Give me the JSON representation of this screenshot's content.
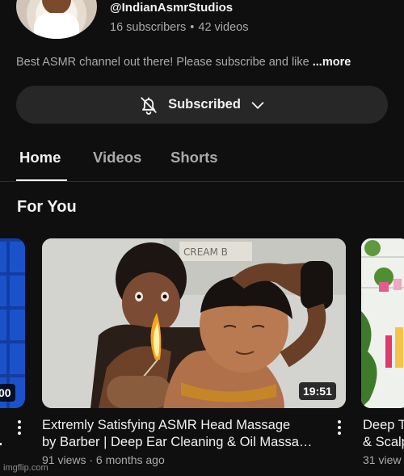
{
  "channel": {
    "handle": "@IndianAsmrStudios",
    "subscribers": "16 subscribers",
    "separator": "•",
    "videos": "42 videos",
    "description": "Best ASMR channel out there! Please subscribe and like ",
    "more": "...more"
  },
  "subscribe": {
    "label": "Subscribed",
    "icons": [
      "bell-off-icon",
      "chevron-down-icon"
    ]
  },
  "tabs": [
    {
      "label": "Home",
      "active": true
    },
    {
      "label": "Videos",
      "active": false
    },
    {
      "label": "Shorts",
      "active": false
    }
  ],
  "section": {
    "title": "For You"
  },
  "videos": [
    {
      "duration": "00",
      "title_line": "",
      "meta": ""
    },
    {
      "duration": "19:51",
      "title_line1": "Extremly Satisfying ASMR Head Massage",
      "title_line2": "by Barber | Deep Ear Cleaning & Oil Massa…",
      "meta": "91 views · 6 months ago"
    },
    {
      "title_line1": "Deep T",
      "title_line2": "& Scalp",
      "meta": "31 view"
    }
  ],
  "watermark": "imgflip.com",
  "colors": {
    "background": "#0f0f0f",
    "pill": "#272727",
    "text_primary": "#f1f1f1",
    "text_secondary": "#aaaaaa"
  }
}
